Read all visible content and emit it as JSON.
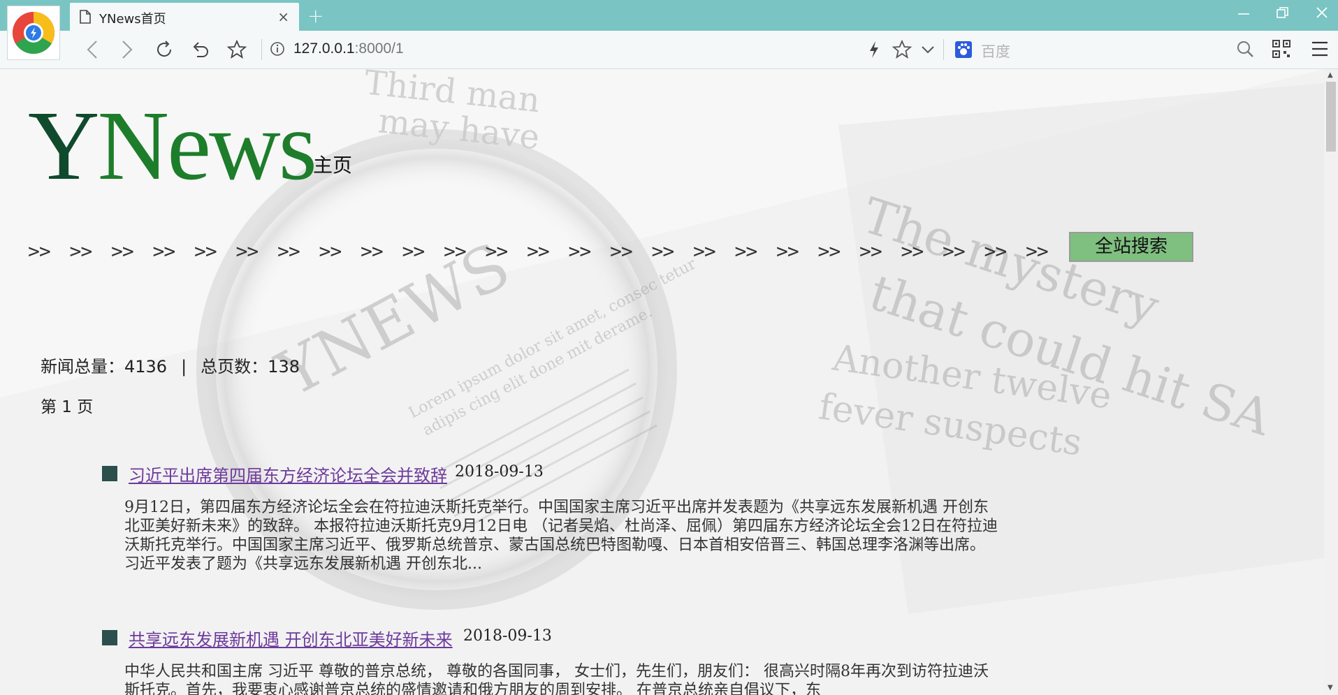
{
  "browser": {
    "tab_title": "YNews首页",
    "tab_close": "×",
    "new_tab": "+",
    "url_host": "127.0.0.1",
    "url_rest": ":8000/1",
    "search_engine": "百度",
    "icons": [
      "back-icon",
      "forward-icon",
      "reload-icon",
      "undo-icon",
      "bookmark-star-icon",
      "info-icon",
      "lightning-icon",
      "favorite-star-icon",
      "dropdown-icon",
      "baidu-icon",
      "search-icon",
      "qr-code-icon",
      "menu-icon"
    ]
  },
  "site": {
    "logo_y": "Y",
    "logo_news": "News",
    "page_label": "主页",
    "nav_arrow": ">>",
    "nav_count": 25,
    "search_button": "全站搜索",
    "stats_total_label": "新闻总量：",
    "stats_total": "4136",
    "stats_sep": "|",
    "stats_pages_label": "总页数：",
    "stats_pages": "138",
    "page_indicator": "第 1 页"
  },
  "articles": [
    {
      "title": "习近平出席第四届东方经济论坛全会并致辞",
      "date": "2018-09-13",
      "summary": "9月12日，第四届东方经济论坛全会在符拉迪沃斯托克举行。中国国家主席习近平出席并发表题为《共享远东发展新机遇 开创东北亚美好新未来》的致辞。 本报符拉迪沃斯托克9月12日电 （记者吴焰、杜尚泽、屈佩）第四届东方经济论坛全会12日在符拉迪沃斯托克举行。中国国家主席习近平、俄罗斯总统普京、蒙古国总统巴特图勒嘎、日本首相安倍晋三、韩国总理李洛渊等出席。 习近平发表了题为《共享远东发展新机遇 开创东北..."
    },
    {
      "title": "共享远东发展新机遇 开创东北亚美好新未来",
      "date": "2018-09-13",
      "summary": "中华人民共和国主席 习近平 尊敬的普京总统， 尊敬的各国同事， 女士们，先生们，朋友们： 很高兴时隔8年再次到访符拉迪沃斯托克。首先，我要衷心感谢普京总统的盛情邀请和俄方朋友的周到安排。 在普京总统亲自倡议下，东"
    }
  ]
}
